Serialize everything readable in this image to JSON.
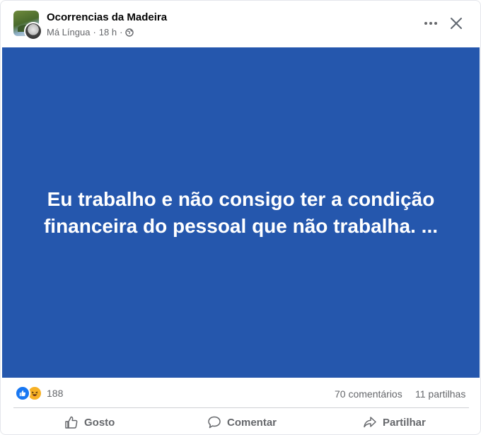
{
  "post": {
    "page_name": "Ocorrencias da Madeira",
    "author": "Má Língua",
    "separator": "·",
    "time": "18 h",
    "separator2": "·",
    "text": "Eu trabalho e não consigo ter a condição financeira do pessoal que não trabalha. ...",
    "background_color": "#2557ad"
  },
  "stats": {
    "reactions": "188",
    "comments": "70 comentários",
    "shares": "11 partilhas"
  },
  "actions": {
    "like": "Gosto",
    "comment": "Comentar",
    "share": "Partilhar"
  },
  "icons": [
    "more-icon",
    "close-icon",
    "globe-icon",
    "like-reaction-icon",
    "haha-reaction-icon",
    "thumbs-up-icon",
    "comment-icon",
    "share-icon"
  ]
}
